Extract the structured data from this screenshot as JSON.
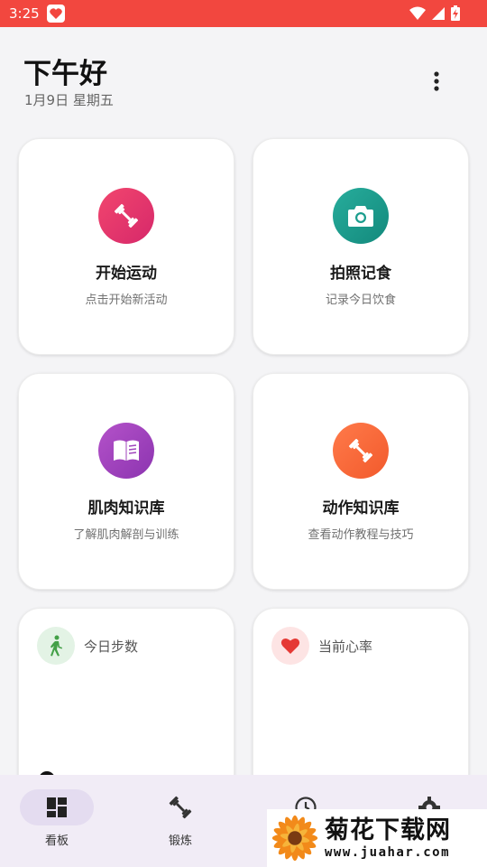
{
  "status_bar": {
    "time": "3:25"
  },
  "header": {
    "greeting": "下午好",
    "date": "1月9日 星期五"
  },
  "cards": [
    {
      "title": "开始运动",
      "subtitle": "点击开始新活动",
      "icon": "dumbbell-icon",
      "gradient": [
        "#f2466e",
        "#d6286a"
      ]
    },
    {
      "title": "拍照记食",
      "subtitle": "记录今日饮食",
      "icon": "camera-icon",
      "gradient": [
        "#27ad9c",
        "#13897c"
      ]
    },
    {
      "title": "肌肉知识库",
      "subtitle": "了解肌肉解剖与训练",
      "icon": "book-icon",
      "gradient": [
        "#b452c9",
        "#8c34b0"
      ]
    },
    {
      "title": "动作知识库",
      "subtitle": "查看动作教程与技巧",
      "icon": "dumbbell-icon",
      "gradient": [
        "#ff7a4a",
        "#f25a2c"
      ]
    }
  ],
  "stats": [
    {
      "label": "今日步数",
      "icon": "walk-icon",
      "icon_bg": "#e3f3e5",
      "icon_color": "#43a047"
    },
    {
      "label": "当前心率",
      "icon": "heart-icon",
      "icon_bg": "#fde4e4",
      "icon_color": "#e53935"
    }
  ],
  "bottom_nav": {
    "items": [
      {
        "label": "看板",
        "icon": "dashboard-icon",
        "active": true
      },
      {
        "label": "锻炼",
        "icon": "dumbbell-icon",
        "active": false
      },
      {
        "label": "",
        "icon": "history-icon",
        "active": false
      },
      {
        "label": "",
        "icon": "settings-icon",
        "active": false
      }
    ]
  },
  "watermark": {
    "title": "菊花下载网",
    "url": "www.juahar.com"
  },
  "colors": {
    "status_bar": "#f2473f",
    "background": "#f4f4f6",
    "nav_bg": "#f1ecf6",
    "nav_active": "#e4dcf0"
  }
}
